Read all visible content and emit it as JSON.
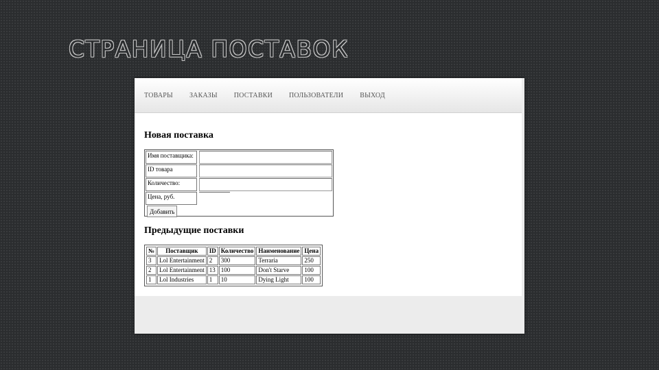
{
  "slide": {
    "title": "СТРАНИЦА ПОСТАВОК"
  },
  "nav": [
    "ТОВАРЫ",
    "ЗАКАЗЫ",
    "ПОСТАВКИ",
    "ПОЛЬЗОВАТЕЛИ",
    "ВЫХОД"
  ],
  "form": {
    "heading": "Новая поставка",
    "fields": [
      {
        "label": "Имя поставщика:",
        "value": ""
      },
      {
        "label": "ID товара",
        "value": ""
      },
      {
        "label": "Количество:",
        "value": ""
      },
      {
        "label": "Цена, руб.",
        "value": ""
      }
    ],
    "submit_label": "Добавить"
  },
  "previous": {
    "heading": "Предыдущие поставки",
    "columns": [
      "№",
      "Поставщик",
      "ID",
      "Количество",
      "Наименование",
      "Цена"
    ],
    "rows": [
      [
        "3",
        "Lol Entertainment",
        "2",
        "300",
        "Terraria",
        "250"
      ],
      [
        "2",
        "Lol Entertainment",
        "13",
        "100",
        "Don't Starve",
        "100"
      ],
      [
        "1",
        "Lol Industries",
        "1",
        "10",
        "Dying Light",
        "100"
      ]
    ]
  }
}
